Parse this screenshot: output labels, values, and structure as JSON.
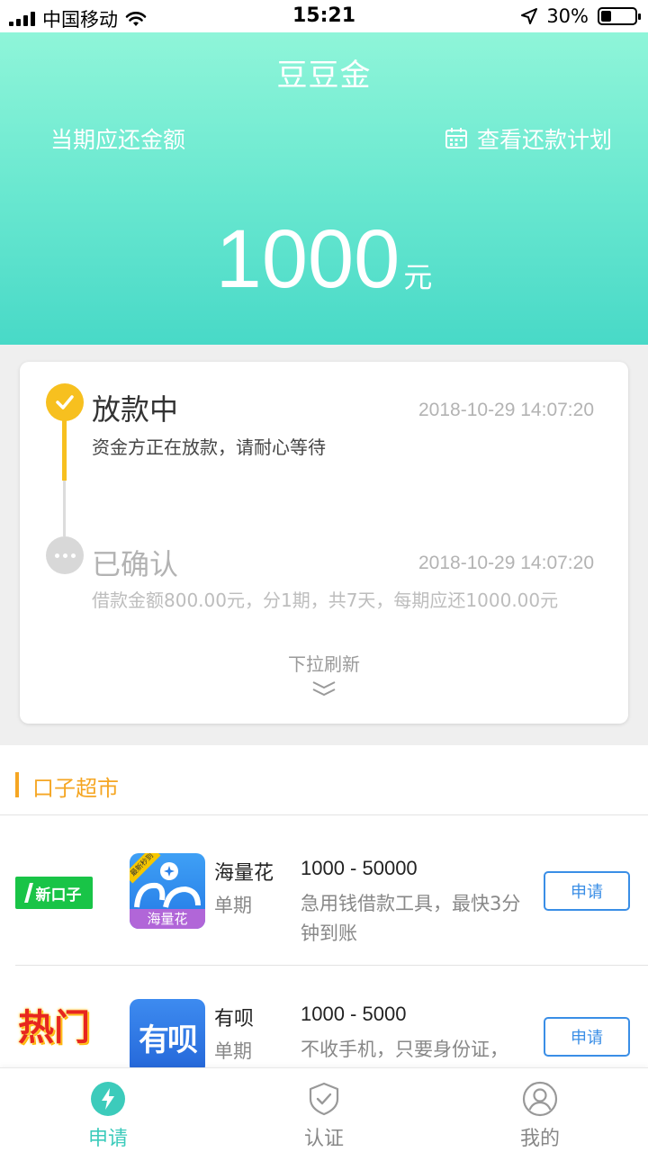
{
  "status_bar": {
    "carrier": "中国移动",
    "time": "15:21",
    "battery": "30%",
    "battery_level": 0.3
  },
  "header": {
    "title": "豆豆金",
    "due_label": "当期应还金额",
    "plan_link": "查看还款计划",
    "amount": "1000",
    "unit": "元"
  },
  "status_card": {
    "steps": [
      {
        "title": "放款中",
        "time": "2018-10-29 14:07:20",
        "desc": "资金方正在放款，请耐心等待"
      },
      {
        "title": "已确认",
        "time": "2018-10-29 14:07:20",
        "desc": "借款金额800.00元，分1期，共7天，每期应还1000.00元"
      }
    ],
    "pull_refresh": "下拉刷新"
  },
  "market": {
    "title": "口子超市",
    "items": [
      {
        "tag": "新口子",
        "logo_text": "海量花",
        "logo_ribbon": "最新秒到",
        "name": "海量花",
        "period": "单期",
        "range": "1000 - 50000",
        "desc": "急用钱借款工具，最快3分钟到账",
        "button": "申请"
      },
      {
        "tag": "热门",
        "logo_text": "有呗",
        "name": "有呗",
        "period": "单期",
        "range": "1000 - 5000",
        "desc": "不收手机，只要身份证，",
        "button": "申请"
      }
    ]
  },
  "tab_bar": {
    "tabs": [
      {
        "label": "申请",
        "icon": "lightning-icon",
        "active": true
      },
      {
        "label": "认证",
        "icon": "shield-check-icon",
        "active": false
      },
      {
        "label": "我的",
        "icon": "user-icon",
        "active": false
      }
    ]
  },
  "colors": {
    "header_top": "#8ff5d9",
    "header_bottom": "#48d9c7",
    "step_active": "#f7c01f",
    "market_accent": "#f5a623",
    "apply_button": "#3a8ee6",
    "tab_active": "#3ccbbb"
  }
}
